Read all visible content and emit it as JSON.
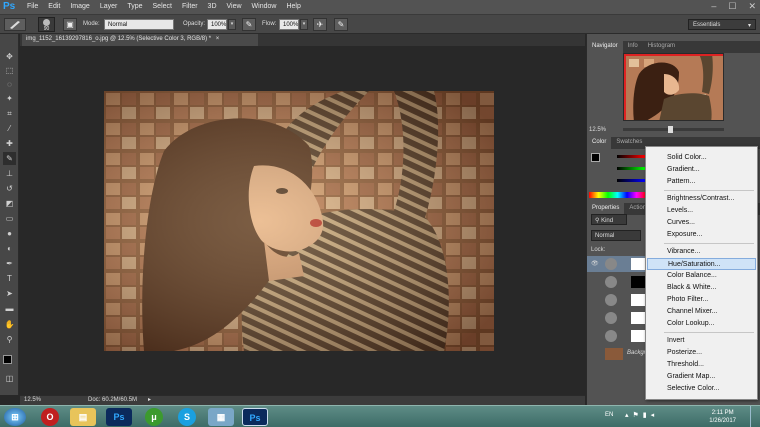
{
  "menubar": {
    "logo": "Ps",
    "items": [
      "File",
      "Edit",
      "Image",
      "Layer",
      "Type",
      "Select",
      "Filter",
      "3D",
      "View",
      "Window",
      "Help"
    ],
    "minimize": "–",
    "maximize": "☐",
    "close": "✕"
  },
  "options": {
    "brush_size": "90",
    "mode_label": "Mode:",
    "mode_value": "Normal",
    "opacity_label": "Opacity:",
    "opacity_value": "100%",
    "flow_label": "Flow:",
    "flow_value": "100%",
    "workspace": "Essentials"
  },
  "document": {
    "tab_title": "img_1152_16139297816_o.jpg @ 12.5% (Selective Color 3, RGB/8) *",
    "tab_close": "×",
    "zoom": "12.5%",
    "doc_size": "Doc: 60.2M/60.5M"
  },
  "navigator": {
    "tabs": [
      "Navigator",
      "Info",
      "Histogram"
    ],
    "zoom": "12.5%"
  },
  "color_panel": {
    "tabs": [
      "Color",
      "Swatches"
    ]
  },
  "properties_panel": {
    "tabs": [
      "Properties",
      "Actions"
    ]
  },
  "layers_panel": {
    "kind_filter": "Kind",
    "blend_mode": "Normal",
    "lock_label": "Lock:",
    "background_label": "Backgr"
  },
  "context_menu": {
    "groups": [
      [
        "Solid Color...",
        "Gradient...",
        "Pattern..."
      ],
      [
        "Brightness/Contrast...",
        "Levels...",
        "Curves...",
        "Exposure..."
      ],
      [
        "Vibrance...",
        "Hue/Saturation...",
        "Color Balance...",
        "Black & White...",
        "Photo Filter...",
        "Channel Mixer...",
        "Color Lookup..."
      ],
      [
        "Invert",
        "Posterize...",
        "Threshold...",
        "Gradient Map...",
        "Selective Color..."
      ]
    ],
    "highlighted": "Hue/Saturation..."
  },
  "taskbar": {
    "apps": [
      "start-orb",
      "opera",
      "file-explorer",
      "photoshop",
      "utorrent",
      "skype",
      "photos",
      "photoshop-active"
    ],
    "language": "EN",
    "time": "2:11 PM",
    "date": "1/26/2017"
  },
  "colors": {
    "accent": "#30a8ff",
    "menu_highlight": "#cfe3f7",
    "lips": "#b51e1e"
  }
}
